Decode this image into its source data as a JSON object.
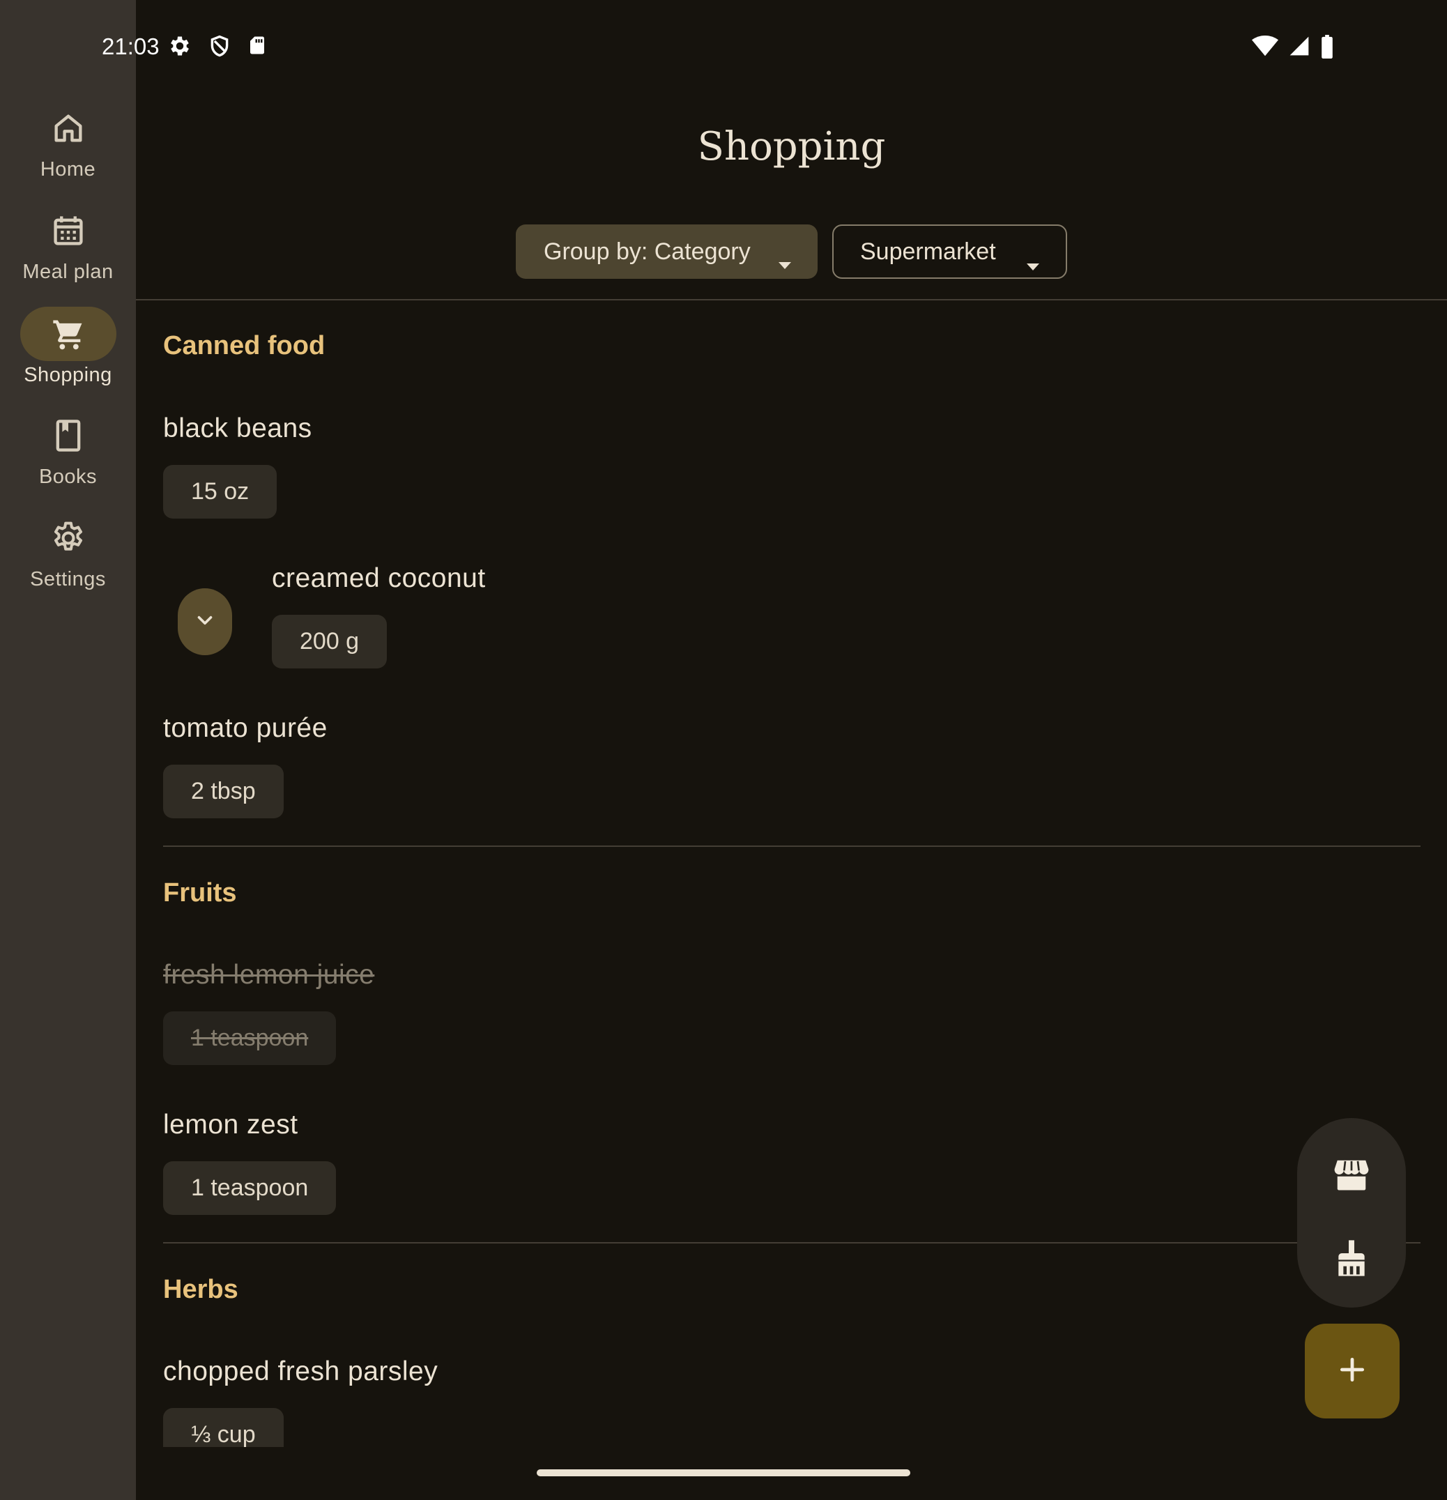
{
  "status_bar": {
    "time": "21:03",
    "left_icons": [
      "gear-icon",
      "shield-icon",
      "sd-card-icon"
    ],
    "right_icons": [
      "wifi-icon",
      "signal-icon",
      "battery-icon"
    ]
  },
  "nav": {
    "items": [
      {
        "label": "Home",
        "icon": "home-icon",
        "active": false
      },
      {
        "label": "Meal plan",
        "icon": "calendar-icon",
        "active": false
      },
      {
        "label": "Shopping",
        "icon": "cart-icon",
        "active": true
      },
      {
        "label": "Books",
        "icon": "book-icon",
        "active": false
      },
      {
        "label": "Settings",
        "icon": "gear-icon",
        "active": false
      }
    ]
  },
  "header": {
    "title": "Shopping",
    "group_by_label": "Group by: Category",
    "store_label": "Supermarket"
  },
  "sections": [
    {
      "title": "Canned food",
      "items": [
        {
          "name": "black beans",
          "qty": "15  oz",
          "checked": false
        },
        {
          "name": "creamed coconut",
          "qty": "200  g",
          "checked": false,
          "expandable": true
        },
        {
          "name": "tomato purée",
          "qty": "2  tbsp",
          "checked": false
        }
      ]
    },
    {
      "title": "Fruits",
      "items": [
        {
          "name": "fresh lemon juice",
          "qty": "1  teaspoon",
          "checked": true
        },
        {
          "name": "lemon zest",
          "qty": "1  teaspoon",
          "checked": false
        }
      ]
    },
    {
      "title": "Herbs",
      "items": [
        {
          "name": "chopped fresh parsley",
          "qty": "⅓ cup",
          "checked": false
        }
      ]
    }
  ],
  "fab": {
    "store_icon": "storefront-icon",
    "clean_icon": "broom-icon",
    "add_icon": "plus-icon"
  },
  "colors": {
    "background": "#16130d",
    "rail": "#38332d",
    "accent": "#e8c27c",
    "active_indicator": "#5a4d2d",
    "fab": "#6b5512"
  }
}
